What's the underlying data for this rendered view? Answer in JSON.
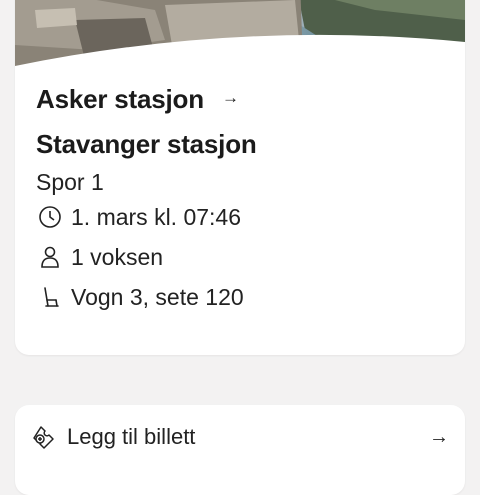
{
  "ticket": {
    "from": "Asker stasjon",
    "arrow": "→",
    "to": "Stavanger stasjon",
    "platform": "Spor 1",
    "details": {
      "time": {
        "icon": "clock-icon",
        "text": "1. mars kl. 07:46"
      },
      "passengers": {
        "icon": "person-icon",
        "text": "1 voksen"
      },
      "seat": {
        "icon": "seat-icon",
        "text": "Vogn 3, sete 120"
      }
    }
  },
  "add_ticket": {
    "icon": "ticket-add-icon",
    "label": "Legg til billett",
    "arrow": "→"
  }
}
